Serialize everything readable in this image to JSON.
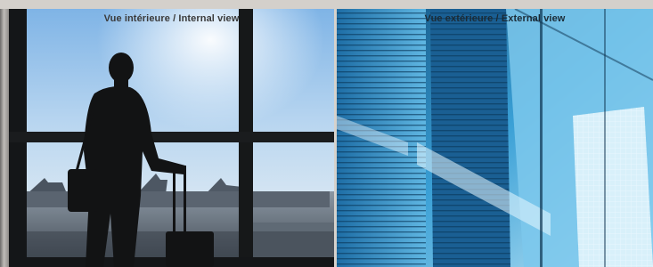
{
  "panels": {
    "internal": {
      "caption": "Vue intérieure / Internal view"
    },
    "external": {
      "caption": "Vue extérieure / External view"
    }
  }
}
